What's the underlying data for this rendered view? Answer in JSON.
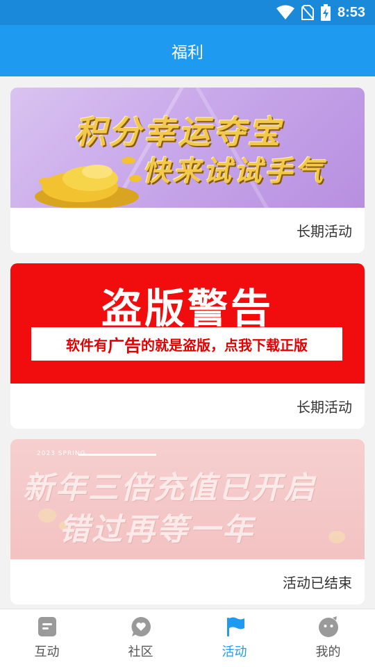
{
  "status_bar": {
    "time": "8:53",
    "icons": [
      "wifi-icon",
      "no-sim-icon",
      "battery-charging-icon"
    ]
  },
  "header": {
    "title": "福利"
  },
  "cards": [
    {
      "banner_line1": "积分幸运夺宝",
      "banner_line2": "快来试试手气",
      "status": "长期活动"
    },
    {
      "banner_title": "盗版警告",
      "banner_sub_a": "软件有",
      "banner_sub_hl": "广告",
      "banner_sub_b": "的就是盗版，点我下载正版",
      "status": "长期活动"
    },
    {
      "banner_tag": "2023 SPRING",
      "banner_line1": "新年三倍充值已开启",
      "banner_line2": "错过再等一年",
      "status": "活动已结束"
    }
  ],
  "bottom_nav": [
    {
      "label": "互动",
      "icon": "interaction-icon",
      "active": false
    },
    {
      "label": "社区",
      "icon": "community-icon",
      "active": false
    },
    {
      "label": "活动",
      "icon": "flag-icon",
      "active": true
    },
    {
      "label": "我的",
      "icon": "profile-icon",
      "active": false
    }
  ],
  "colors": {
    "header": "#1e9bf0",
    "status_bar": "#1a89d9",
    "active": "#1e9bf0",
    "inactive_icon": "#9a9a9a"
  }
}
